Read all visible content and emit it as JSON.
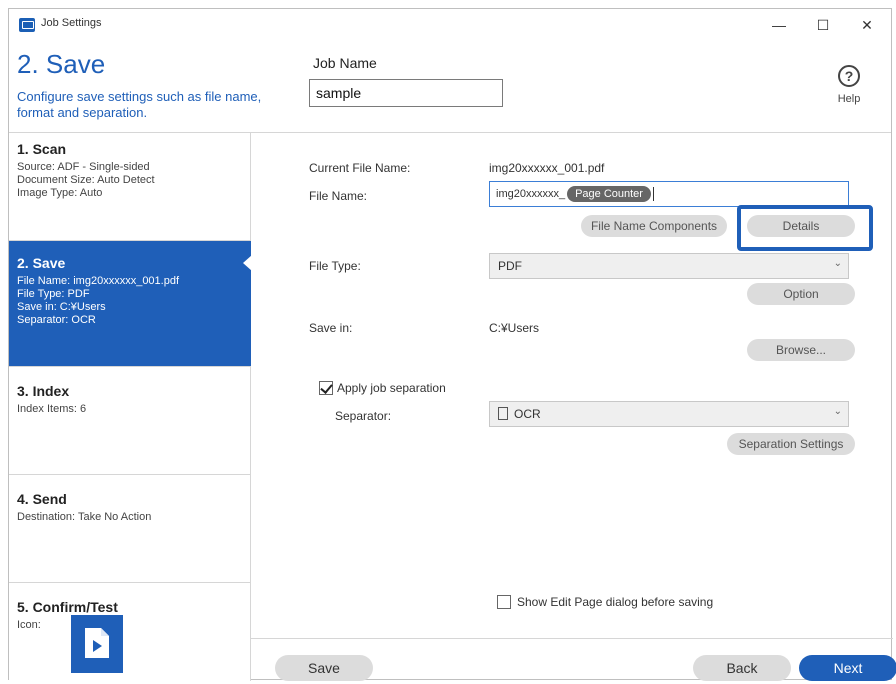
{
  "window": {
    "title": "Job Settings",
    "minimize": "—",
    "maximize": "☐",
    "close": "✕"
  },
  "header": {
    "step_title": "2. Save",
    "description": "Configure save settings such as file name, format and separation.",
    "job_name_label": "Job Name",
    "job_name_value": "sample",
    "help_label": "Help",
    "help_glyph": "?"
  },
  "sidebar": {
    "scan": {
      "title": "1. Scan",
      "lines": [
        "Source: ADF - Single-sided",
        "Document Size: Auto Detect",
        "Image Type: Auto"
      ]
    },
    "save": {
      "title": "2. Save",
      "lines": [
        "File Name: img20xxxxxx_001.pdf",
        "File Type: PDF",
        "Save in: C:¥Users",
        "Separator: OCR"
      ]
    },
    "index": {
      "title": "3. Index",
      "lines": [
        "Index Items: 6"
      ]
    },
    "send": {
      "title": "4. Send",
      "lines": [
        "Destination: Take No Action"
      ]
    },
    "confirm": {
      "title": "5. Confirm/Test",
      "lines": [
        "Icon:"
      ]
    }
  },
  "main": {
    "current_file_label": "Current File Name:",
    "current_file_value": "img20xxxxxx_001.pdf",
    "file_name_label": "File Name:",
    "file_name_prefix": "img20xxxxxx_",
    "file_name_chip": "Page Counter",
    "file_name_components_button": "File Name Components",
    "details_button": "Details",
    "file_type_label": "File Type:",
    "file_type_value": "PDF",
    "option_button": "Option",
    "save_in_label": "Save in:",
    "save_in_value": "C:¥Users",
    "browse_button": "Browse...",
    "apply_separation_label": "Apply job separation",
    "separator_label": "Separator:",
    "separator_value": "OCR",
    "separation_settings_button": "Separation Settings",
    "show_edit_page_label": "Show Edit Page dialog before saving"
  },
  "footer": {
    "save": "Save",
    "back": "Back",
    "next": "Next"
  },
  "colors": {
    "accent": "#1f5fb8"
  }
}
